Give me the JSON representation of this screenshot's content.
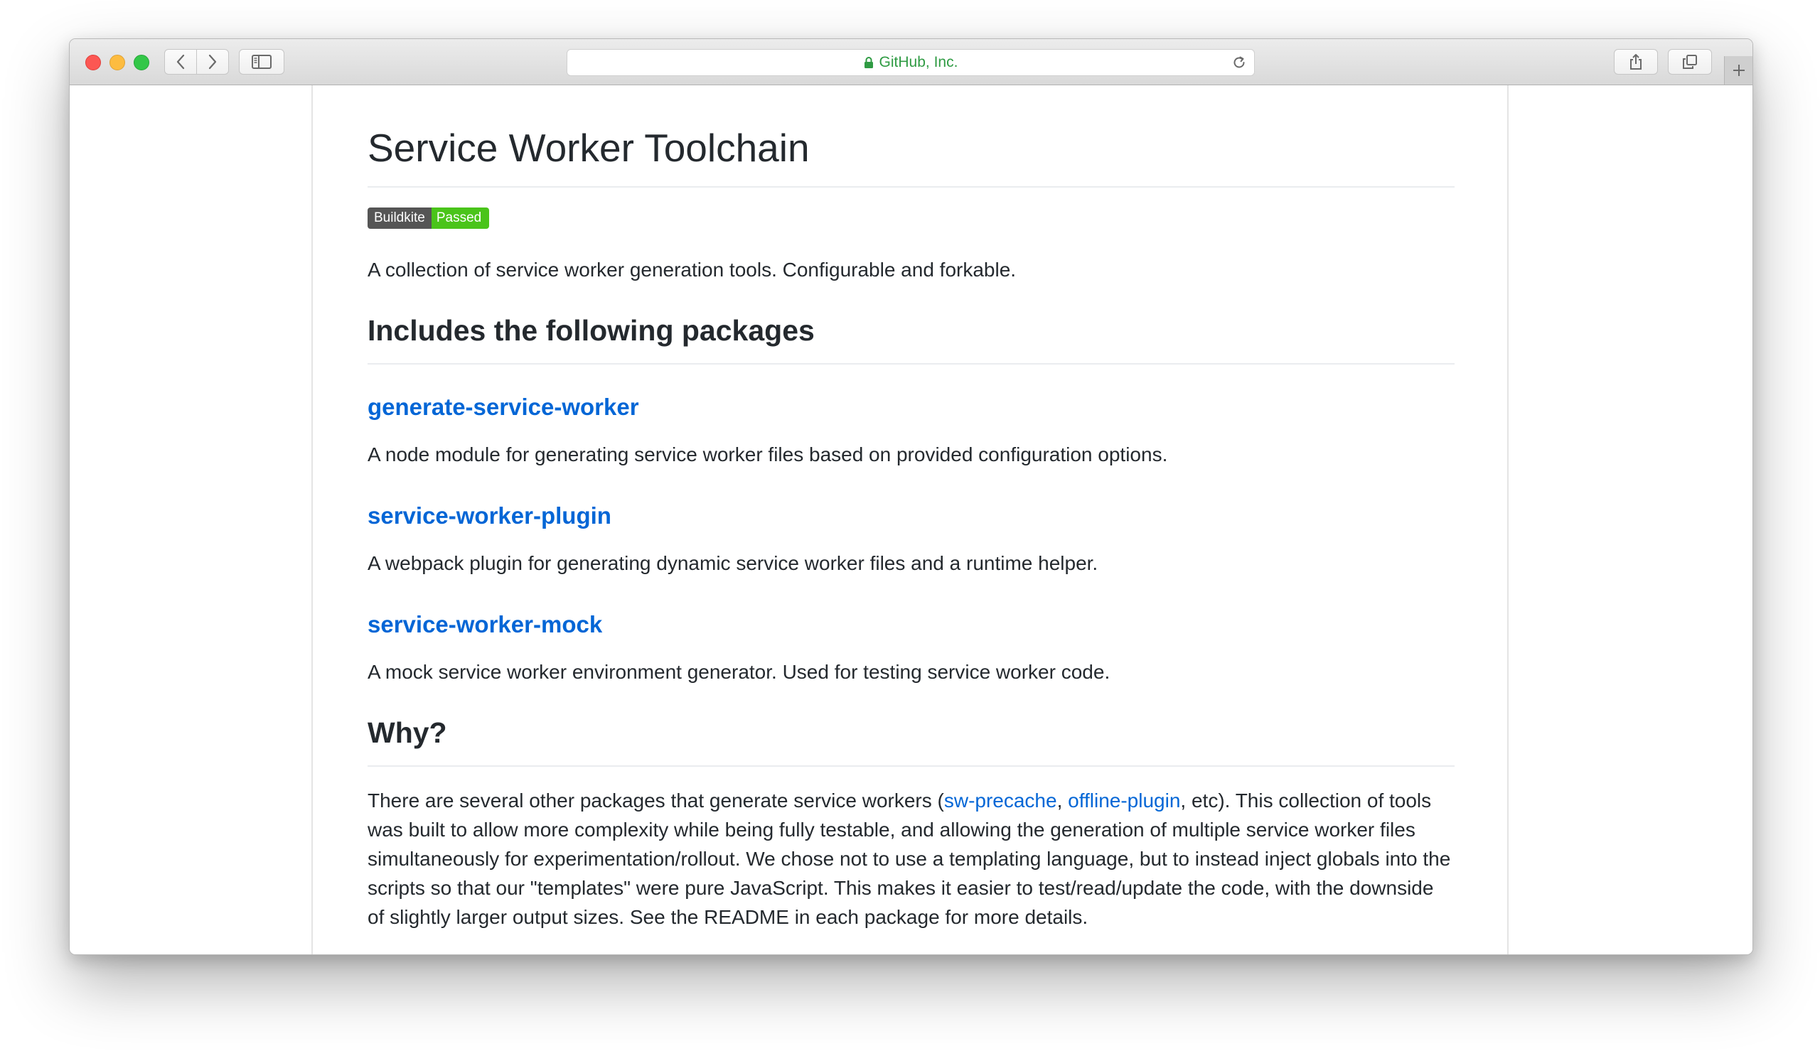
{
  "browser": {
    "address": "GitHub, Inc.",
    "colors": {
      "address_text": "#2f9b43",
      "link": "#0366d6",
      "badge_status": "#4ac41a"
    }
  },
  "readme": {
    "title": "Service Worker Toolchain",
    "badge": {
      "label": "Buildkite",
      "status": "Passed"
    },
    "intro": "A collection of service worker generation tools. Configurable and forkable.",
    "packages_heading": "Includes the following packages",
    "packages": [
      {
        "name": "generate-service-worker",
        "description": "A node module for generating service worker files based on provided configuration options."
      },
      {
        "name": "service-worker-plugin",
        "description": "A webpack plugin for generating dynamic service worker files and a runtime helper."
      },
      {
        "name": "service-worker-mock",
        "description": "A mock service worker environment generator. Used for testing service worker code."
      }
    ],
    "why_heading": "Why?",
    "why": {
      "before": "There are several other packages that generate service workers (",
      "link1": "sw-precache",
      "sep": ", ",
      "link2": "offline-plugin",
      "after": ", etc). This collection of tools was built to allow more complexity while being fully testable, and allowing the generation of multiple service worker files simultaneously for experimentation/rollout. We chose not to use a templating language, but to instead inject globals into the scripts so that our \"templates\" were pure JavaScript. This makes it easier to test/read/update the code, with the downside of slightly larger output sizes. See the README in each package for more details."
    }
  }
}
